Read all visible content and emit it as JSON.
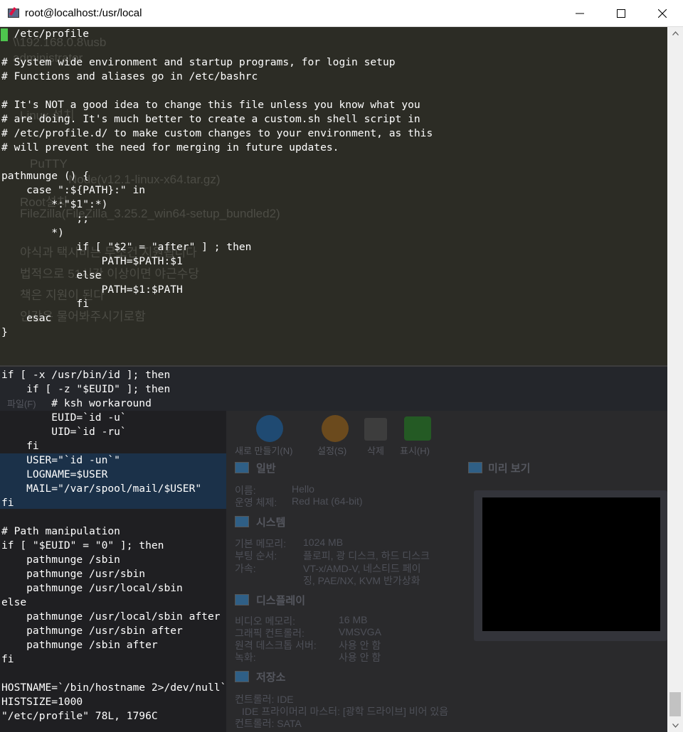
{
  "window": {
    "title": "root@localhost:/usr/local",
    "icon": "putty-icon"
  },
  "terminal": {
    "lines": [
      "# /etc/profile",
      "",
      "# System wide environment and startup programs, for login setup",
      "# Functions and aliases go in /etc/bashrc",
      "",
      "# It's NOT a good idea to change this file unless you know what you",
      "# are doing. It's much better to create a custom.sh shell script in",
      "# /etc/profile.d/ to make custom changes to your environment, as this",
      "# will prevent the need for merging in future updates.",
      "",
      "pathmunge () {",
      "    case \":${PATH}:\" in",
      "        *:\"$1\":*)",
      "            ;;",
      "        *)",
      "            if [ \"$2\" = \"after\" ] ; then",
      "                PATH=$PATH:$1",
      "            else",
      "                PATH=$1:$PATH",
      "            fi",
      "    esac",
      "}",
      "",
      "",
      "if [ -x /usr/bin/id ]; then",
      "    if [ -z \"$EUID\" ]; then",
      "        # ksh workaround",
      "        EUID=`id -u`",
      "        UID=`id -ru`",
      "    fi",
      "    USER=\"`id -un`\"",
      "    LOGNAME=$USER",
      "    MAIL=\"/var/spool/mail/$USER\"",
      "fi",
      "",
      "# Path manipulation",
      "if [ \"$EUID\" = \"0\" ]; then",
      "    pathmunge /sbin",
      "    pathmunge /usr/sbin",
      "    pathmunge /usr/local/sbin",
      "else",
      "    pathmunge /usr/local/sbin after",
      "    pathmunge /usr/sbin after",
      "    pathmunge /sbin after",
      "fi",
      "",
      "HOSTNAME=`/bin/hostname 2>/dev/null`",
      "HISTSIZE=1000",
      "\"/etc/profile\" 78L, 1796C"
    ]
  },
  "ghost_document": {
    "lines": [
      "\\\\192.168.0.8\\usb",
      "administrator",
      "Linux 설치",
      "PuTTY",
      "Node(v12.1-linux-x64.tar.gz)",
      "Root설치",
      "FileZilla(FileZilla_3.25.2_win64-setup_bundled2)",
      "야식과 택시비는 무조건 지원됩니다",
      "법적으로 51시간 이상이면 야근수당",
      "책은 지원이 된다",
      "인강은 물어봐주시기로함"
    ]
  },
  "ghost_vm_manager": {
    "menu_file": "파일(F)",
    "toolbar": {
      "new": "새로 만들기(N)",
      "settings": "설정(S)",
      "discard": "삭제",
      "show": "표시(H)"
    },
    "general": {
      "header": "일반",
      "name_label": "이름:",
      "name_value": "Hello",
      "os_label": "운영 체제:",
      "os_value": "Red Hat (64-bit)"
    },
    "preview_header": "미리 보기",
    "system": {
      "header": "시스템",
      "memory_label": "기본 메모리:",
      "memory_value": "1024 MB",
      "boot_label": "부팅 순서:",
      "boot_value": "플로피, 광 디스크, 하드 디스크",
      "accel_label": "가속:",
      "accel_value1": "VT-x/AMD-V, 네스티드 페이",
      "accel_value2": "징, PAE/NX, KVM 반가상화"
    },
    "display": {
      "header": "디스플레이",
      "vmem_label": "비디오 메모리:",
      "vmem_value": "16 MB",
      "gfx_label": "그래픽 컨트롤러:",
      "gfx_value": "VMSVGA",
      "rdp_label": "원격 데스크톱 서버:",
      "rdp_value": "사용 안 함",
      "rec_label": "녹화:",
      "rec_value": "사용 안 함"
    },
    "storage": {
      "header": "저장소",
      "ctrl_ide": "컨트롤러: IDE",
      "ide_master": "IDE 프라이머리 마스터:  [광학 드라이브] 비어 있음",
      "ctrl_sata": "컨트롤러: SATA"
    }
  },
  "colors": {
    "terminal_text": "#ffffff",
    "cursor": "#4ec54e",
    "titlebar": "#ffffff"
  }
}
